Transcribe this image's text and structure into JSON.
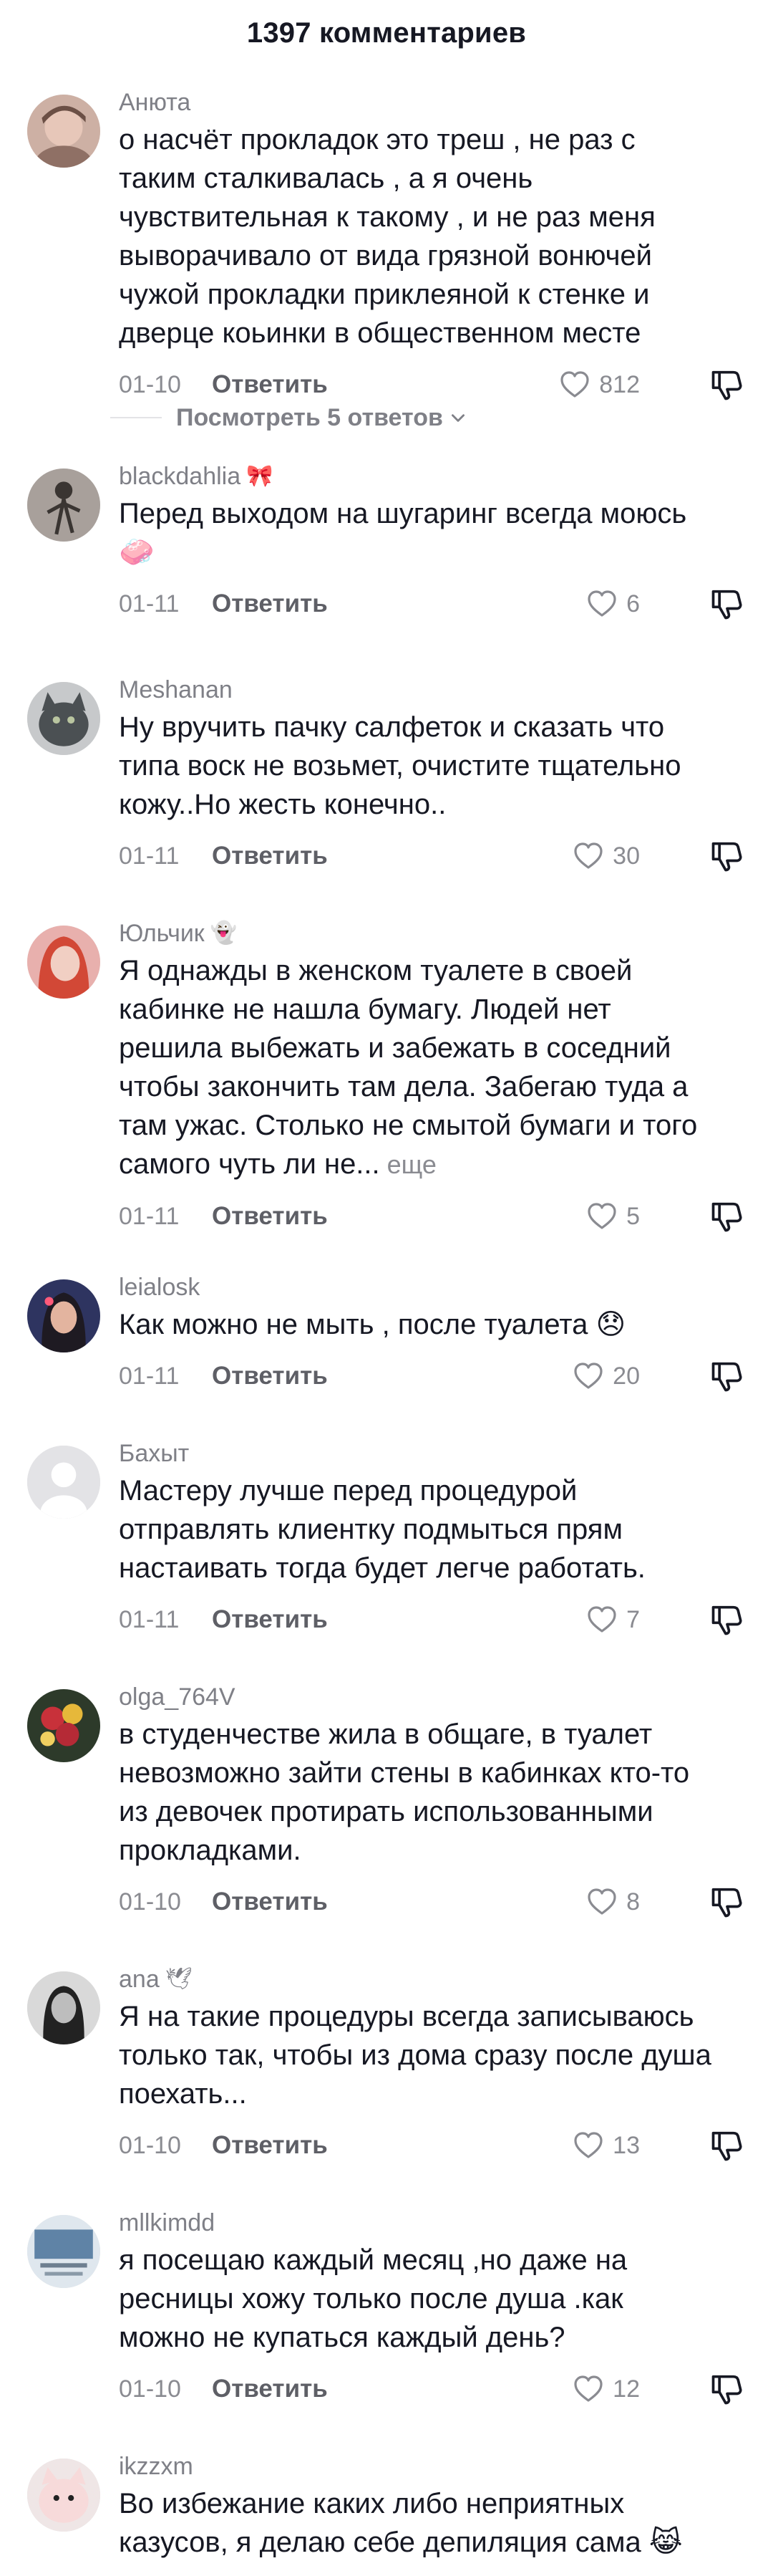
{
  "header": {
    "title": "1397 комментариев"
  },
  "reply_label": "Ответить",
  "more_label": "еще",
  "view_replies": {
    "label": "Посмотреть 5 ответов"
  },
  "comments": [
    {
      "username": "Анюта",
      "deco": "",
      "text": "о насчёт прокладок это треш , не раз с таким сталкивалась , а я очень чувствительная к такому , и не раз меня выворачивало от вида грязной вонючей чужой прокладки приклеяной к стенке и дверце коьинки в общественном месте",
      "date": "01-10",
      "likes": "812",
      "avatar_color": "#c9a79a"
    },
    {
      "username": "blackdahlia",
      "deco": "🎀",
      "text": "Перед выходом на шугаринг всегда моюсь 🧼",
      "date": "01-11",
      "likes": "6",
      "avatar_color": "#9a8d86"
    },
    {
      "username": "Meshanan",
      "deco": "",
      "text": "Ну вручить пачку салфеток и сказать что типа воск не возьмет, очистите тщательно кожу..Но жесть конечно..",
      "date": "01-11",
      "likes": "30",
      "avatar_color": "#6b6f72"
    },
    {
      "username": "Юльчик",
      "deco": "👻",
      "text": "Я однажды в женском туалете в своей кабинке не нашла бумагу. Людей нет решила выбежать и забежать в соседний чтобы закончить там дела. Забегаю туда а там ужас. Столько не смытой бумаги и того самого чуть ли не...",
      "more": true,
      "date": "01-11",
      "likes": "5",
      "avatar_color": "#d65a4e"
    },
    {
      "username": "leialosk",
      "deco": "",
      "text": "Как можно не мыть , после туалета 😞",
      "date": "01-11",
      "likes": "20",
      "avatar_color": "#3b3f6e"
    },
    {
      "username": "Бахыт",
      "deco": "",
      "text": "Мастеру лучше перед процедурой отправлять клиентку подмыться прям настаивать тогда будет легче работать.",
      "date": "01-11",
      "likes": "7",
      "avatar_color": "#e6e6e9"
    },
    {
      "username": "olga_764V",
      "deco": "",
      "text": "в студенчестве жила в общаге, в туалет невозможно зайти стены в кабинках кто-то из девочек протирать использованными прокладками.",
      "date": "01-10",
      "likes": "8",
      "avatar_color": "#a9333a"
    },
    {
      "username": "ana",
      "deco": "🕊",
      "text": "Я на такие процедуры всегда записываюсь только так, чтобы из дома сразу после душа поехать...",
      "date": "01-10",
      "likes": "13",
      "avatar_color": "#4a4a4a"
    },
    {
      "username": "mllkimdd",
      "deco": "",
      "text": "я посещаю каждый месяц ,но даже на ресницы хожу только после душа .как можно не купаться каждый день?",
      "date": "01-10",
      "likes": "12",
      "avatar_color": "#7b9bb5"
    },
    {
      "username": "ikzzxm",
      "deco": "",
      "text": "Во избежание каких либо неприятных казусов, я делаю себе депиляция сама 😹",
      "date": "",
      "likes": "",
      "avatar_color": "#f2d6d6"
    }
  ],
  "colors": {
    "text": "#161823",
    "muted": "#8a8b91",
    "username": "#7f8087"
  }
}
